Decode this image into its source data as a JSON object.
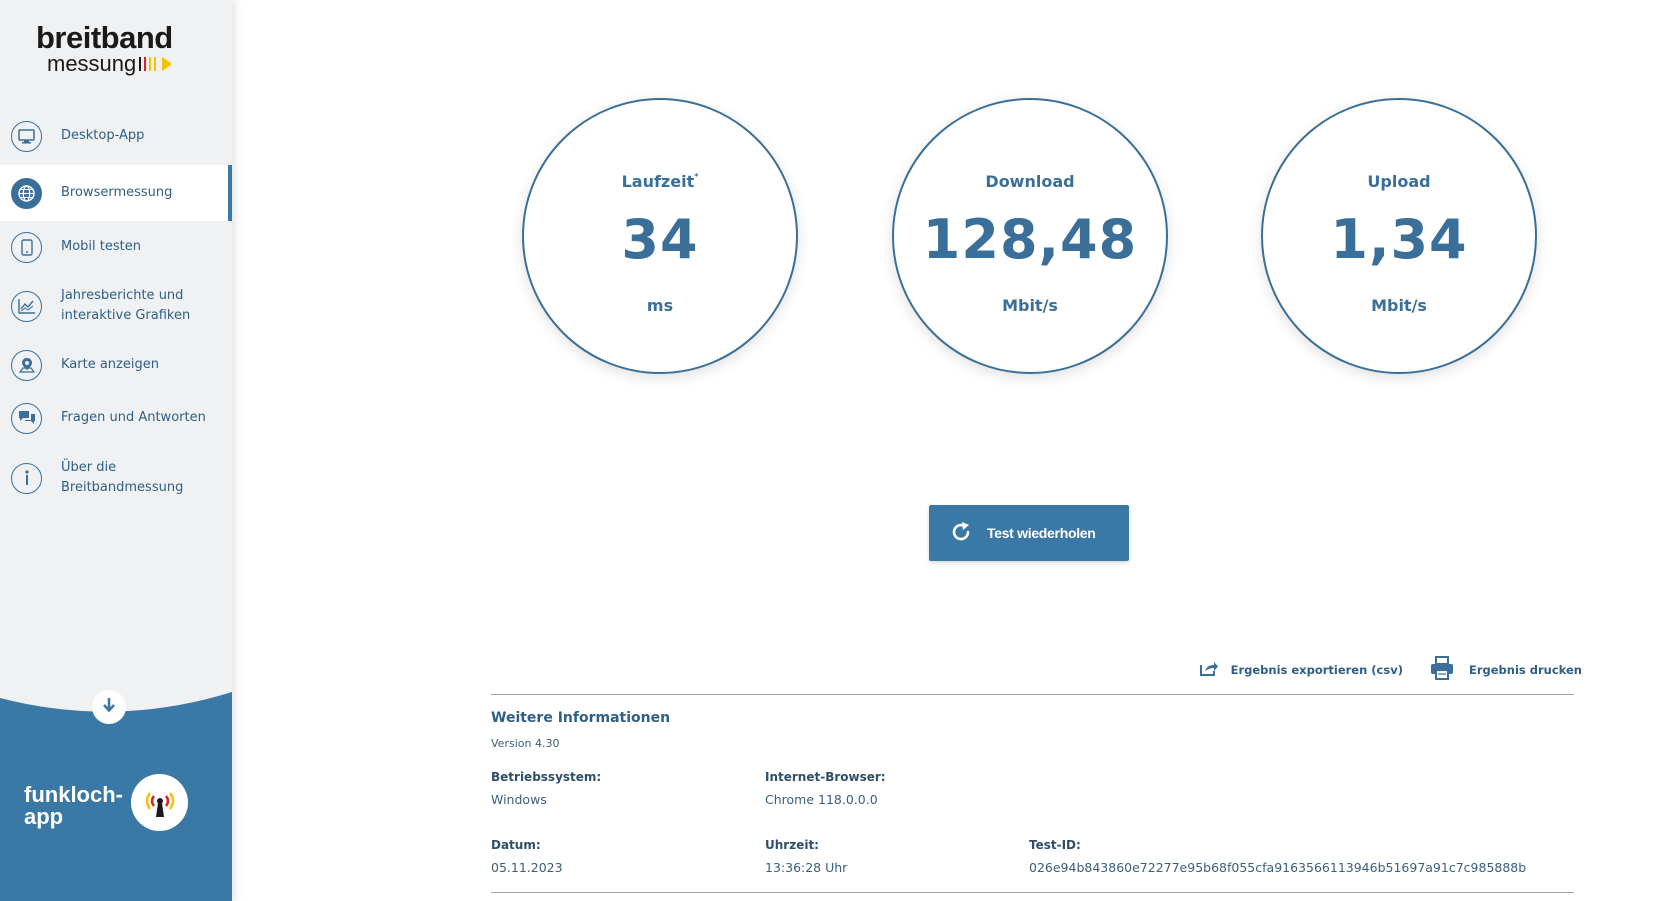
{
  "logo": {
    "main": "breitband",
    "sub": "messung"
  },
  "sidebar": {
    "items": [
      {
        "label": "Desktop-App",
        "icon": "monitor-icon",
        "active": false
      },
      {
        "label": "Browsermessung",
        "icon": "globe-icon",
        "active": true
      },
      {
        "label": "Mobil testen",
        "icon": "smartphone-icon",
        "active": false
      },
      {
        "label": "Jahresberichte und\ninteraktive Grafiken",
        "icon": "chart-icon",
        "active": false
      },
      {
        "label": "Karte anzeigen",
        "icon": "map-pin-icon",
        "active": false
      },
      {
        "label": "Fragen und Antworten",
        "icon": "chat-icon",
        "active": false
      },
      {
        "label": "Über die\nBreitbandmessung",
        "icon": "info-icon",
        "active": false
      }
    ],
    "footer": {
      "app_name_line1": "funkloch-",
      "app_name_line2": "app"
    }
  },
  "results": {
    "latency": {
      "label": "Laufzeit",
      "marker": "*",
      "value": "34",
      "unit": "ms"
    },
    "download": {
      "label": "Download",
      "value": "128,48",
      "unit": "Mbit/s"
    },
    "upload": {
      "label": "Upload",
      "value": "1,34",
      "unit": "Mbit/s"
    }
  },
  "buttons": {
    "repeat": "Test wiederholen",
    "export": "Ergebnis exportieren (csv)",
    "print": "Ergebnis drucken"
  },
  "info": {
    "title": "Weitere Informationen",
    "version": "Version 4.30",
    "os_label": "Betriebssystem:",
    "os_value": "Windows",
    "browser_label": "Internet-Browser:",
    "browser_value": "Chrome 118.0.0.0",
    "date_label": "Datum:",
    "date_value": "05.11.2023",
    "time_label": "Uhrzeit:",
    "time_value": "13:36:28 Uhr",
    "testid_label": "Test-ID:",
    "testid_value": "026e94b843860e72277e95b68f055cfa9163566113946b51697a91c7c985888b"
  },
  "colors": {
    "primary": "#3a78a6",
    "text": "#3a6f9a",
    "sidebar_bg": "#f0f1f3"
  }
}
